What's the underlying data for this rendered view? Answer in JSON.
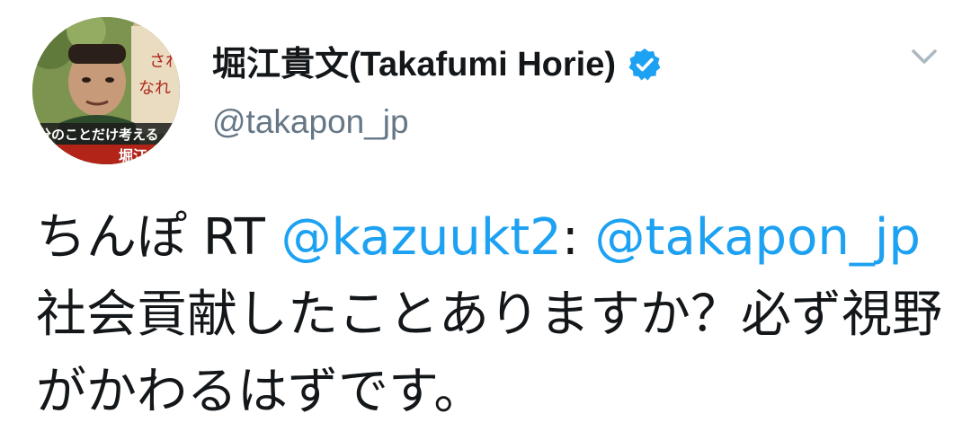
{
  "author": {
    "display_name": "堀江貴文(Takafumi Horie)",
    "handle": "@takapon_jp",
    "avatar_icon": "profile-photo-icon",
    "verified_icon": "verified-badge-icon",
    "verified_color": "#1da1f2"
  },
  "menu": {
    "icon": "chevron-down-icon"
  },
  "tweet": {
    "text_start": "ちんぽ RT ",
    "mention_1": "@kazuukt2",
    "colon": ": ",
    "mention_2": "@takapon_jp",
    "text_end": "　社会貢献したことありますか？必ず視野がかわるはずです。"
  },
  "colors": {
    "text": "#14171a",
    "secondary": "#657786",
    "link": "#1da1f2",
    "chevron": "#aab8c2"
  }
}
